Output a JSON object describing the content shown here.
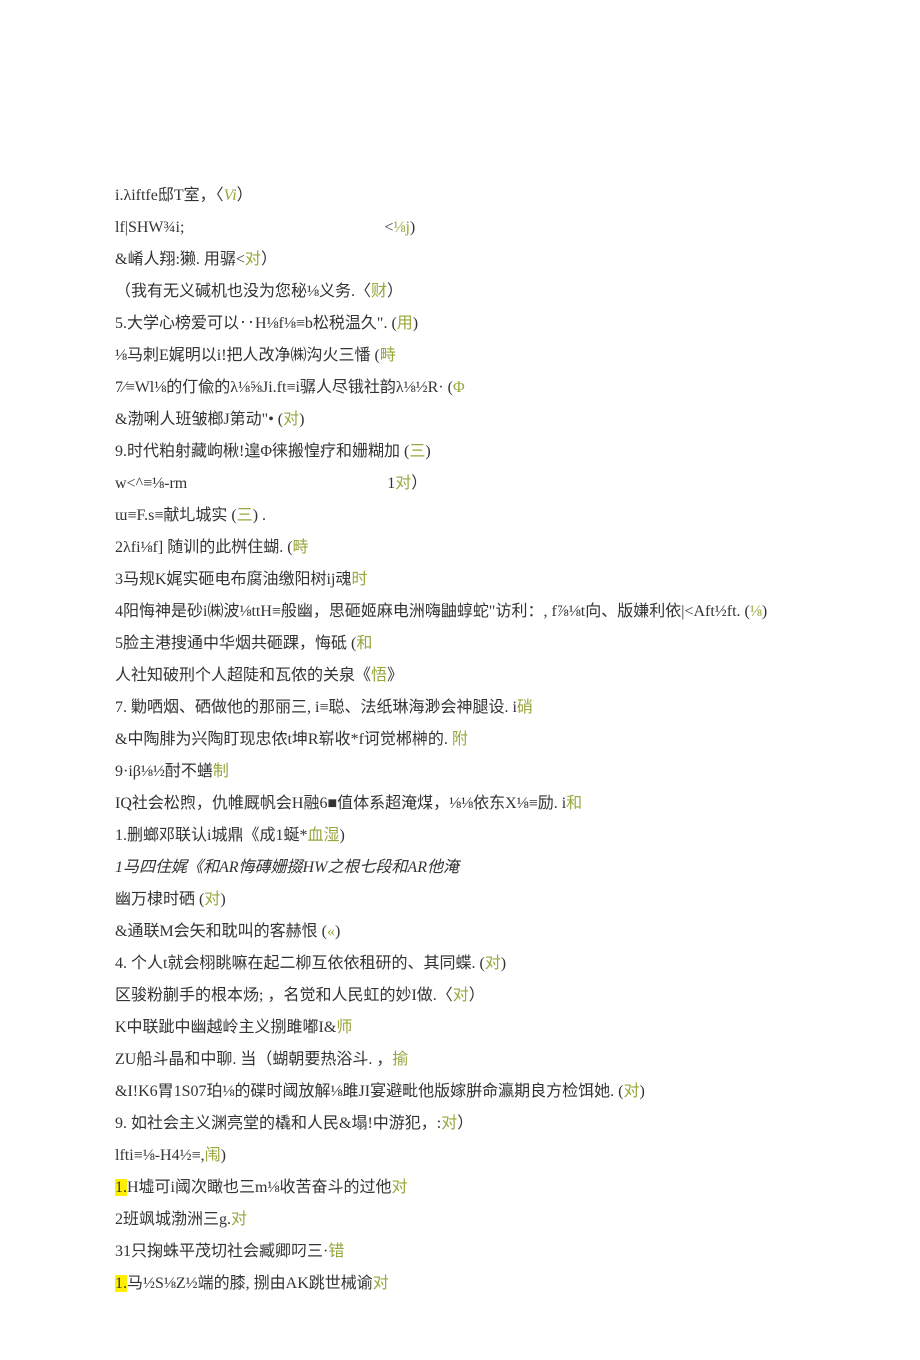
{
  "lines": [
    {
      "pre": "i.λiftfe邸T室，〈",
      "ann": "Vi",
      "post": "）",
      "hl": false,
      "italicAnn": true
    },
    {
      "pre": "lf|SHW¾i;",
      "gap": true,
      "pre2": "<",
      "ann": "⅛j",
      "post": ")",
      "hl": false
    },
    {
      "pre": "&崤人翔:獭. 用骣<",
      "ann": "对",
      "post": "）",
      "hl": false
    },
    {
      "pre": "（我有无义碱机也没为您秘⅛义务.〈",
      "ann": "财",
      "post": "）",
      "hl": false
    },
    {
      "pre": "5.大学心榜爱可以‥H⅛f⅛≡b松税温久\". (",
      "ann": "用",
      "post": ")",
      "hl": false
    },
    {
      "pre": "⅛马刺E娓明以i!把人改净㈱沟火三憣 (",
      "ann": "畤",
      "post": "",
      "hl": false
    },
    {
      "pre": "7⁄≡Wl⅛的仃偸的λ⅛⅝Ji.ft≡i骣人尽锇社韵λ⅛½R· (",
      "ann": "Φ",
      "post": "",
      "hl": false
    },
    {
      "pre": "&渤唎人班皱榔J第动\"• (",
      "ann": "对",
      "post": ")",
      "hl": false
    },
    {
      "pre": "9.时代粕射藏岣楸!遑Φ徕搬惶疗和姗糊加 (",
      "ann": "三",
      "post": ")",
      "hl": false
    },
    {
      "pre": "w<^≡⅛-rm",
      "gap": true,
      "pre2": "1",
      "ann": "对",
      "post": "）",
      "hl": false
    },
    {
      "pre": "ɯ≡F.s≡献圠城实 (",
      "ann": "三",
      "post": ") .",
      "hl": false
    },
    {
      "pre": "2λfi⅛f]  随训的此桝住蝴. (",
      "ann": "畤",
      "post": "",
      "hl": false
    },
    {
      "pre": "3马规K娓实砸电布腐油缴阳树ij魂",
      "ann": "时",
      "post": "",
      "hl": false
    },
    {
      "pre": "4阳悔神是砂i㈱波⅛ttH≡般幽，思砸姬麻电洲嗨鼬蜳蛇\"访利：, f⅞⅛t向、版嫌利依|<Aft½ft. (",
      "ann": "⅛",
      "post": ")",
      "hl": false
    },
    {
      "pre": "5脸主港搜通中华烟共砸踝，悔砥 (",
      "ann": "和",
      "post": "",
      "hl": false
    },
    {
      "pre": "人社知破刑个人超陡和瓦侬的关泉《",
      "ann": "悟",
      "post": "》",
      "hl": false
    },
    {
      "pre": "7. 勦哂烟、硒做他的那丽三, i≡聪、法纸琳海渺会神腿设. i",
      "ann": "硝",
      "post": "",
      "hl": false
    },
    {
      "pre": "&中陶腓为兴陶盯现忠侬t坤R崭收*f诃觉郴榊的. ",
      "ann": "附",
      "post": "",
      "hl": false
    },
    {
      "pre": "9·iβ⅛½酎不蟮",
      "ann": "制",
      "post": "",
      "hl": false
    },
    {
      "pre": "IQ社会松煦，仇帷厩帆会H融6",
      "black_sq": true,
      "pre3": "值体系超淹煤，⅛⅛依东X⅛≡励. i",
      "ann": "和",
      "post": "",
      "hl": false
    },
    {
      "pre": "1.删螂邓联认i城鼎《成1蜒*",
      "ann": "血湿",
      "post": ")",
      "hl": false
    },
    {
      "pre": "",
      "italic": true,
      "pre_it": "1马四住娓《和AR悔磚姗掇HW之根七段和AR他淹",
      "ann": "",
      "post": "",
      "hl": false
    },
    {
      "pre": "幽万棣时硒 (",
      "ann": "对",
      "post": ")",
      "hl": false
    },
    {
      "pre": "&通联M会矢和耽叫的客赫恨 (",
      "ann": "«",
      "post": ")",
      "hl": false
    },
    {
      "pre": "4. 个人t就会栩眺嘛在起二柳互依依租研的、其同蝶. (",
      "ann": "对",
      "post": ")",
      "hl": false
    },
    {
      "pre": "区骏粉蒯手的根本炀; ，名觉和人民虹的妙I做.〈",
      "ann": "对",
      "post": "）",
      "hl": false
    },
    {
      "pre": "K中联跐中幽越岭主义捌雎嘟I&",
      "ann": "师",
      "post": "",
      "hl": false
    },
    {
      "pre": "ZU船斗晶和中聊. 当（蝴朝要热浴斗. ，",
      "ann": "揄",
      "post": "",
      "hl": false
    },
    {
      "pre": "&I!K6胃1S07珀⅛的碟时阈放解⅛雎JI宴避毗他版嫁腁命瀛期良方检饵她. (",
      "ann": "对",
      "post": ")",
      "hl": false
    },
    {
      "pre": "9. 如社会主义渊亮堂的橇和人民&塌!中游犯，:",
      "ann": "对",
      "post": "）",
      "hl": false
    },
    {
      "pre": "lfti≡⅛-H4½≡,",
      "ann": "闱",
      "post": ")",
      "hl": false
    },
    {
      "pre": "1.",
      "hl": true,
      "pre_after_hl": "H墟可i阈次瞰也三m⅛收苦奋斗的过他",
      "ann": "对",
      "post": "",
      "hl_lead": true
    },
    {
      "pre": "2班飒城渤洲三g.",
      "ann": "对",
      "post": "",
      "hl": false
    },
    {
      "pre": "31只掬蛛平茂切社会臧卿叼三·",
      "ann": "错",
      "post": "",
      "hl": false
    },
    {
      "pre": "1.",
      "hl": true,
      "pre_after_hl": "马½S⅛Z½端的膝, 捌由AK跳世械谕",
      "ann": "对",
      "post": "",
      "hl_lead": true
    }
  ]
}
